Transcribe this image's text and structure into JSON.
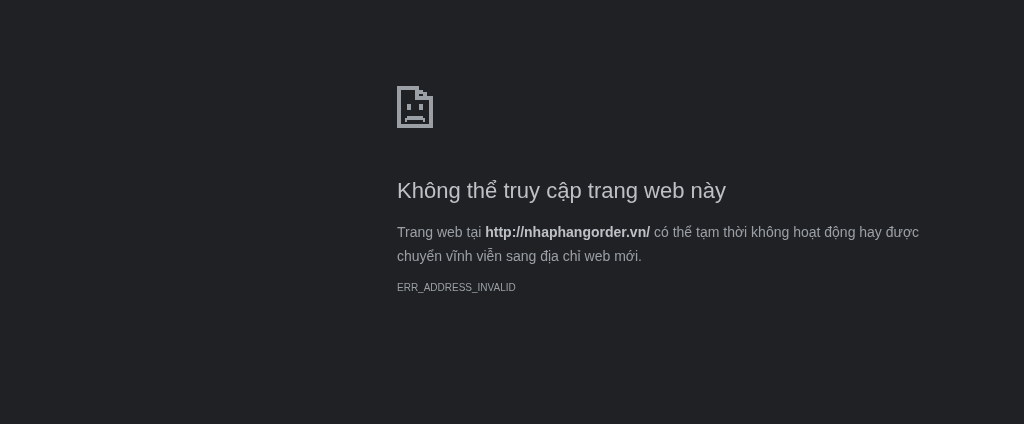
{
  "title": "Không thể truy cập trang web này",
  "message": "Trang web tại **http://nhaphangorder.vn/** có thể tạm thời không hoạt động hay được chuyển vĩnh viễn sang địa chỉ web mới.",
  "error_code": "ERR_ADDRESS_INVALID"
}
